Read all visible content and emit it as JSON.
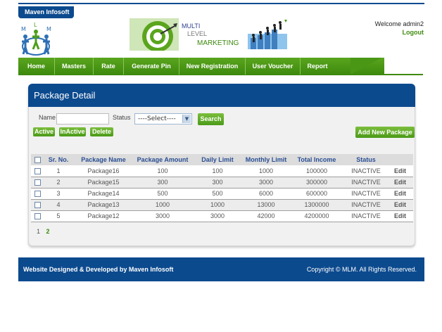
{
  "header": {
    "brand_tab": "Maven Infosoft",
    "logo_letters": [
      "M",
      "L",
      "M"
    ],
    "banner_lines": [
      "MULTI",
      "LEVEL",
      "MARKETING"
    ],
    "welcome": "Welcome admin2",
    "logout": "Logout"
  },
  "nav": {
    "items": [
      {
        "label": "Home"
      },
      {
        "label": "Masters"
      },
      {
        "label": "Rate"
      },
      {
        "label": "Generate Pin"
      },
      {
        "label": "New Registration"
      },
      {
        "label": "User Voucher"
      },
      {
        "label": "Report"
      }
    ]
  },
  "panel": {
    "title": "Package Detail",
    "filter": {
      "name_label": "Name",
      "name_value": "",
      "status_label": "Status",
      "status_selected": "----Select----",
      "search_label": "Search"
    },
    "actions": {
      "active": "Active",
      "inactive": "InActive",
      "delete": "Delete",
      "add_new": "Add New Package"
    },
    "table": {
      "headers": [
        "Sr. No.",
        "Package Name",
        "Package Amount",
        "Daily Limit",
        "Monthly Limit",
        "Total Income",
        "Status"
      ],
      "rows": [
        {
          "sr": "1",
          "name": "Package16",
          "amount": "100",
          "daily": "100",
          "monthly": "1000",
          "total": "100000",
          "status": "INACTIVE",
          "edit": "Edit"
        },
        {
          "sr": "2",
          "name": "Package15",
          "amount": "300",
          "daily": "300",
          "monthly": "3000",
          "total": "300000",
          "status": "INACTIVE",
          "edit": "Edit"
        },
        {
          "sr": "3",
          "name": "Package14",
          "amount": "500",
          "daily": "500",
          "monthly": "6000",
          "total": "600000",
          "status": "INACTIVE",
          "edit": "Edit"
        },
        {
          "sr": "4",
          "name": "Package13",
          "amount": "1000",
          "daily": "1000",
          "monthly": "13000",
          "total": "1300000",
          "status": "INACTIVE",
          "edit": "Edit"
        },
        {
          "sr": "5",
          "name": "Package12",
          "amount": "3000",
          "daily": "3000",
          "monthly": "42000",
          "total": "4200000",
          "status": "INACTIVE",
          "edit": "Edit"
        }
      ]
    },
    "pager": {
      "pages": [
        "1",
        "2"
      ],
      "current": "2"
    }
  },
  "footer": {
    "left": "Website Designed & Developed by Maven Infosoft",
    "right": "Copyright © MLM. All Rights Reserved."
  },
  "colors": {
    "brand_blue": "#0c4a8e",
    "accent_green": "#4b9a18",
    "header_text": "#2a4f94"
  }
}
